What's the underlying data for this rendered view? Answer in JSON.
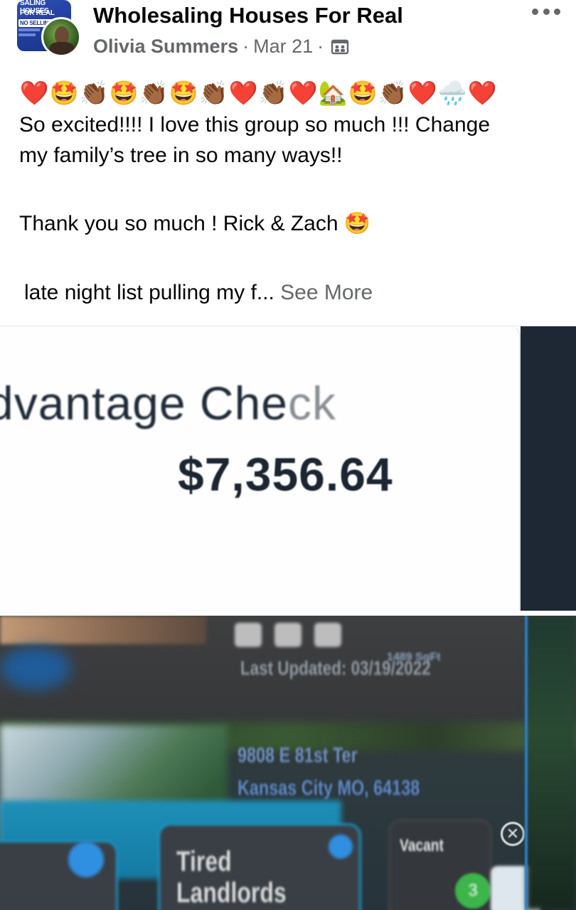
{
  "post": {
    "group_name": "Wholesaling Houses For Real",
    "author": "Olivia Summers",
    "separator": "·",
    "date": "Mar 21",
    "group_avatar": {
      "line1": "SALING HOUSES",
      "line2": "FOR REAL",
      "line3": "NO SELLING"
    },
    "emojis": [
      "❤️",
      "🤩",
      "👏🏾",
      "🤩",
      "👏🏾",
      "🤩",
      "👏🏾",
      "❤️",
      "👏🏾",
      "❤️",
      "🏡",
      "🤩",
      "👏🏾",
      "❤️",
      "🌧️",
      "❤️"
    ],
    "text_line1": "So excited!!!! I love this group so much !!! Change",
    "text_line2": "my family’s tree in so many ways!!",
    "text_line3": "Thank you so much ! Rick & Zach 🤩",
    "text_line4": "late night list pulling my f...",
    "see_more": "See More"
  },
  "image1": {
    "title_main": "dvantage Che",
    "title_fade": "ck",
    "amount": "$7,356.64"
  },
  "image2": {
    "last_updated": "Last Updated: 03/19/2022",
    "sqft": "1489 SqFt",
    "address_line1": "9808 E 81st Ter",
    "address_line2": "Kansas City MO, 64138",
    "tile_label1": "Tired",
    "tile_label2": "Landlords",
    "vacant_label": "Vacant",
    "badge_count": "3",
    "close_glyph": "✕"
  },
  "icons": {
    "more": "more-horizontal-icon",
    "privacy": "group-privacy-icon"
  }
}
